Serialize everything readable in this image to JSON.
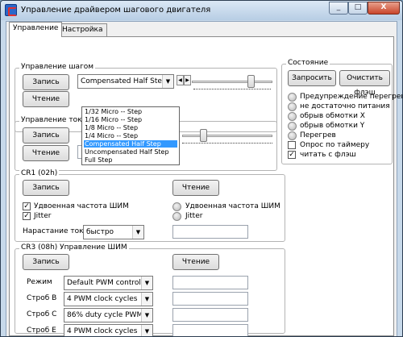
{
  "window": {
    "title": "Управление драйвером шагового двигателя"
  },
  "caption_buttons": {
    "minimize": "_",
    "maximize": "□",
    "close": "X"
  },
  "tabs": [
    {
      "label": "Управление",
      "active": true
    },
    {
      "label": "Настройка",
      "active": false
    }
  ],
  "step_group": {
    "title": "Управление шагом",
    "write_label": "Запись",
    "read_label": "Чтение",
    "combo_value": "Compensated Half Step",
    "dropdown_options": [
      "1/32 Micro -- Step",
      "1/16 Micro -- Step",
      "1/8 Micro -- Step",
      "1/4 Micro -- Step",
      "Compensated Half Step",
      "Uncompensated Half Step",
      "Full Step"
    ],
    "dropdown_selected_index": 4
  },
  "current_group": {
    "title": "Управление током",
    "write_label": "Запись",
    "read_label": "Чтение"
  },
  "status_group": {
    "title": "Состояние",
    "request_label": "Запросить",
    "clear_flash_label": "Очистить флэш",
    "indicators": [
      "Предупреждение перегрева",
      "не достаточно питания",
      "обрыв обмотки X",
      "обрыв обмотки Y",
      "Перегрев"
    ],
    "timer_poll": {
      "label": "Опрос по таймеру",
      "checked": false
    },
    "read_flash": {
      "label": "читать с флэш",
      "checked": true
    }
  },
  "cr1_group": {
    "title": "CR1 (02h)",
    "write_label": "Запись",
    "read_label": "Чтение",
    "double_pwm": {
      "label": "Удвоенная частота ШИМ",
      "checked": true
    },
    "jitter": {
      "label": "Jitter",
      "checked": true
    },
    "read_double_pwm_label": "Удвоенная частота ШИМ",
    "read_jitter_label": "Jitter",
    "current_rise_label": "Нарастание тока",
    "current_rise_value": "быстро"
  },
  "cr3_group": {
    "title": "CR3 (08h) Управление ШИМ",
    "write_label": "Запись",
    "read_label": "Чтение",
    "rows": [
      {
        "label": "Режим",
        "value": "Default PWM control"
      },
      {
        "label": "Строб B",
        "value": "4 PWM clock cycles"
      },
      {
        "label": "Строб C",
        "value": "86% duty cycle PWM regu"
      },
      {
        "label": "Строб E",
        "value": "4 PWM clock cycles"
      }
    ]
  },
  "colors": {
    "selection": "#3399ff",
    "close_button": "#c9452b",
    "title_bar": "#b7cde4"
  }
}
